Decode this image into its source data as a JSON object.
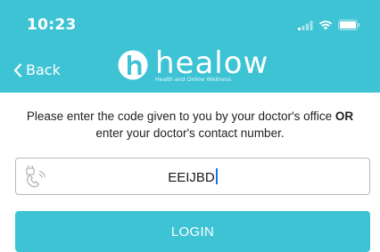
{
  "status_bar": {
    "time": "10:23",
    "icons": [
      "signal-icon",
      "wifi-icon",
      "battery-icon"
    ]
  },
  "nav": {
    "back_label": "Back"
  },
  "brand": {
    "name": "healow",
    "tagline": "Health and Online Wellness",
    "color": "#3ec3d5"
  },
  "instructions": {
    "part1": "Please enter the code given to you by your doctor's office ",
    "emphasis": "OR",
    "part2": " enter your doctor's contact number."
  },
  "code_field": {
    "value": "EEIJBD",
    "icon": "phone-lock-icon"
  },
  "login_button": {
    "label": "LOGIN"
  }
}
